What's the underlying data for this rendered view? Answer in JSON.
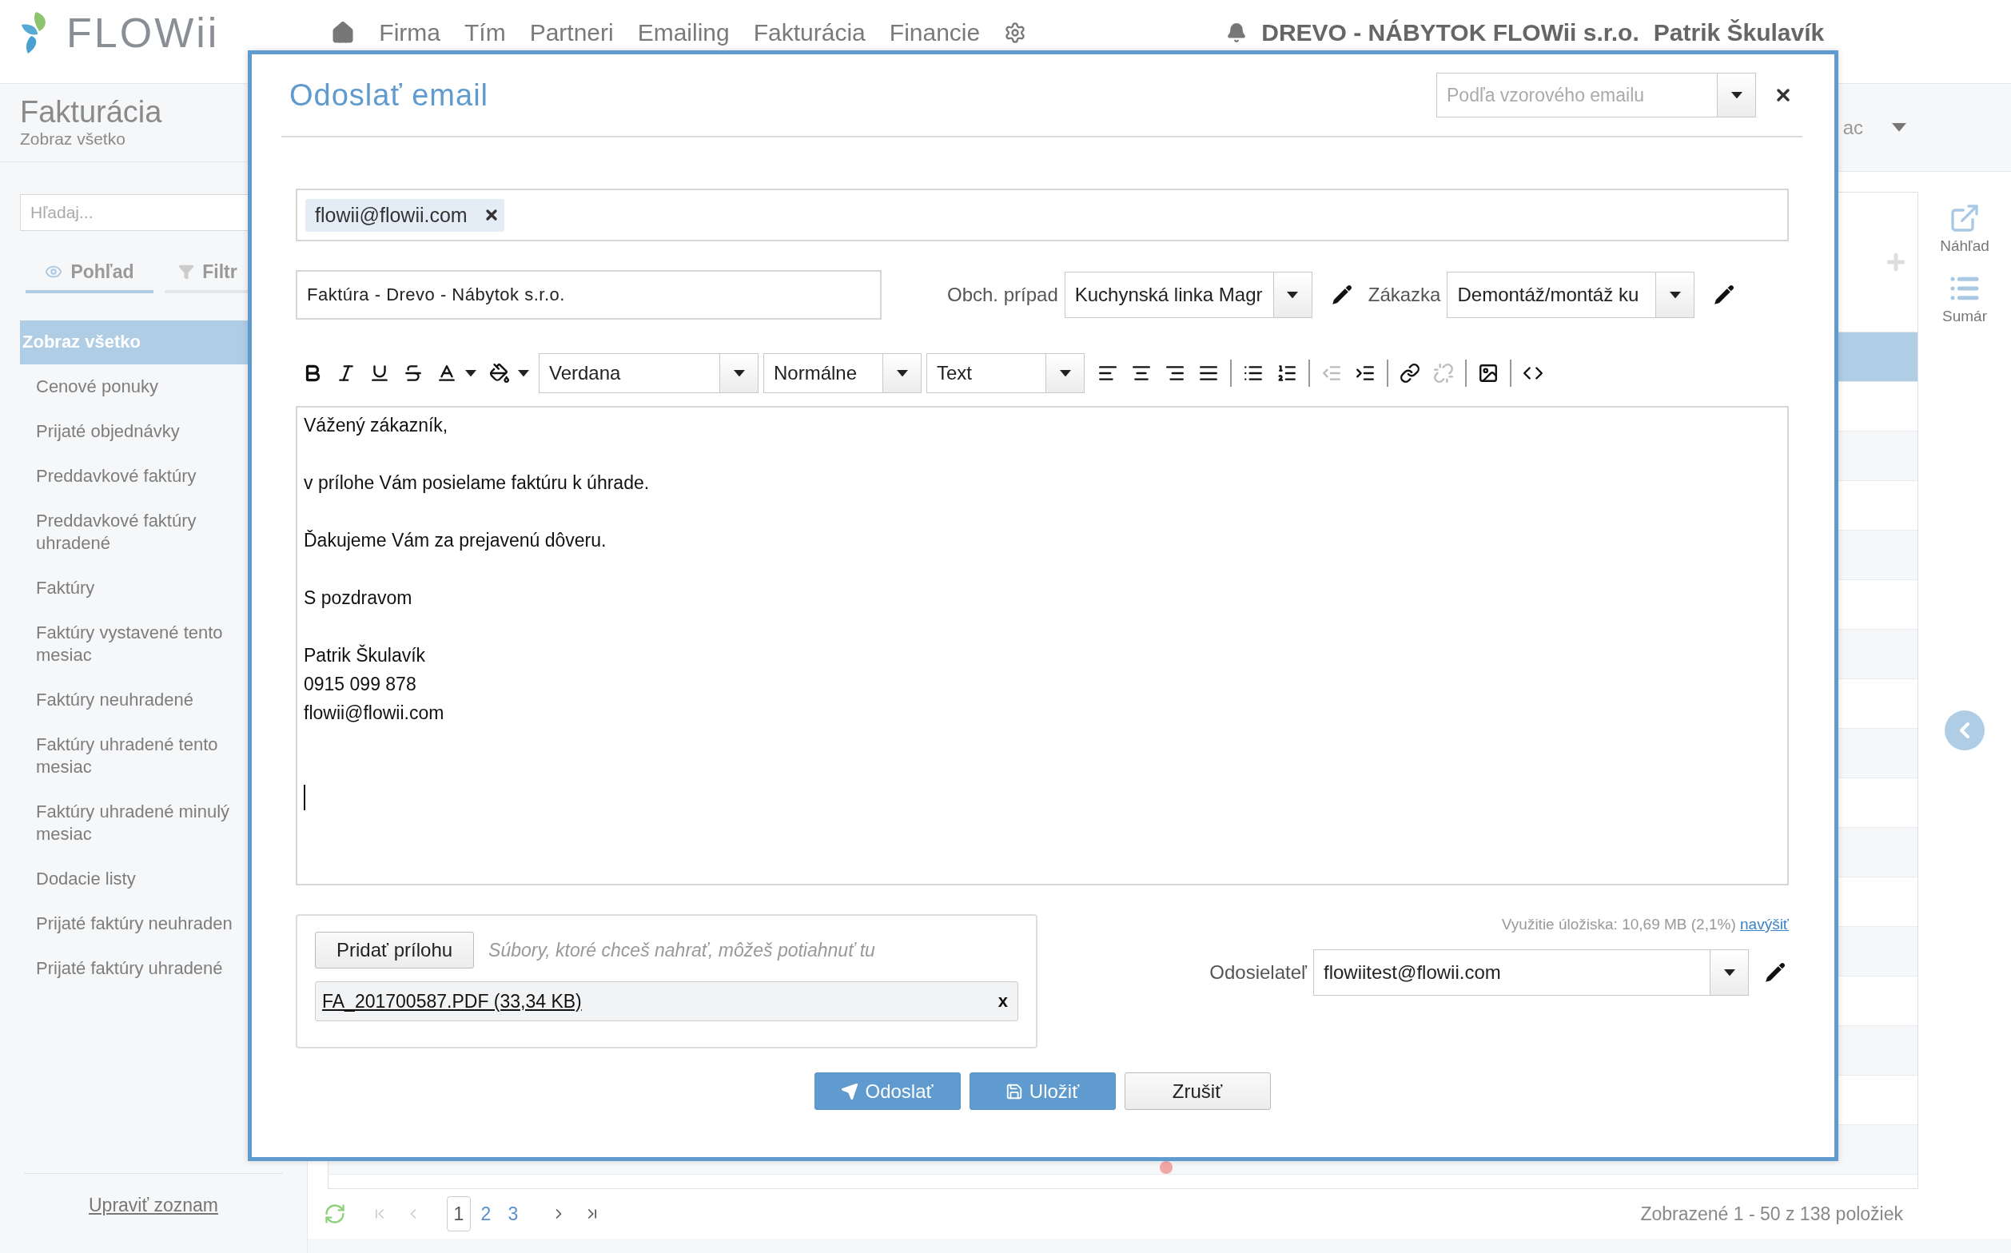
{
  "header": {
    "logo": "FLOWii",
    "nav": [
      {
        "label": "Firma"
      },
      {
        "label": "Tím"
      },
      {
        "label": "Partneri"
      },
      {
        "label": "Emailing"
      },
      {
        "label": "Fakturácia"
      },
      {
        "label": "Financie"
      }
    ],
    "company": "DREVO - NÁBYTOK FLOWii s.r.o.",
    "user": "Patrik Škulavík"
  },
  "sidebar": {
    "title": "Fakturácia",
    "subtitle": "Zobraz všetko",
    "search_placeholder": "Hľadaj...",
    "tabs": [
      {
        "label": "Pohľad",
        "kind": "view",
        "selected": true
      },
      {
        "label": "Filtr",
        "kind": "filter",
        "selected": false
      }
    ],
    "items": [
      {
        "label": "Zobraz všetko",
        "selected": true
      },
      {
        "label": "Cenové ponuky",
        "selected": false
      },
      {
        "label": "Prijaté objednávky",
        "selected": false
      },
      {
        "label": "Preddavkové faktúry",
        "selected": false
      },
      {
        "label": "Preddavkové faktúry uhradené",
        "selected": false
      },
      {
        "label": "Faktúry",
        "selected": false
      },
      {
        "label": "Faktúry vystavené tento mesiac",
        "selected": false
      },
      {
        "label": "Faktúry neuhradené",
        "selected": false
      },
      {
        "label": "Faktúry uhradené tento mesiac",
        "selected": false
      },
      {
        "label": "Faktúry uhradené minulý mesiac",
        "selected": false
      },
      {
        "label": "Dodacie listy",
        "selected": false
      },
      {
        "label": "Prijaté faktúry neuhraden",
        "selected": false
      },
      {
        "label": "Prijaté faktúry uhradené",
        "selected": false
      }
    ],
    "footer_link": "Upraviť zoznam"
  },
  "main": {
    "filter_fragment": "ac",
    "table": {
      "rows": [
        {
          "selected": true
        },
        {
          "selected": false
        },
        {
          "selected": false
        },
        {
          "selected": false
        },
        {
          "selected": false
        },
        {
          "selected": false
        },
        {
          "selected": false
        },
        {
          "selected": false
        },
        {
          "selected": false
        },
        {
          "selected": false
        },
        {
          "selected": false
        },
        {
          "selected": false
        },
        {
          "selected": false
        },
        {
          "selected": false
        },
        {
          "selected": false
        },
        {
          "selected": false
        },
        {
          "selected": false,
          "color": "#f2a7a7"
        }
      ]
    },
    "tools": [
      {
        "kind": "preview",
        "label": "Náhľad"
      },
      {
        "kind": "summary",
        "label": "Sumár"
      }
    ],
    "pagination": {
      "pages": [
        {
          "label": "1",
          "selected": true
        },
        {
          "label": "2",
          "selected": false
        },
        {
          "label": "3",
          "selected": false
        }
      ],
      "summary": "Zobrazené 1 - 50 z 138 položiek"
    }
  },
  "dialog": {
    "title": "Odoslať email",
    "template_placeholder": "Podľa vzorového emailu",
    "recipients": [
      {
        "email": "flowii@flowii.com"
      }
    ],
    "subject": "Faktúra - Drevo - Nábytok s.r.o.",
    "business_case": {
      "label": "Obch. prípad",
      "value": "Kuchynská linka Magr"
    },
    "order": {
      "label": "Zákazka",
      "value": "Demontáž/montáž ku"
    },
    "toolbar": {
      "groups": [
        [
          {
            "kind": "bold"
          },
          {
            "kind": "italic"
          },
          {
            "kind": "underline"
          },
          {
            "kind": "strike"
          },
          {
            "kind": "text-color"
          },
          {
            "kind": "fill-color"
          }
        ],
        [
          {
            "kind": "align-left"
          },
          {
            "kind": "align-center"
          },
          {
            "kind": "align-right"
          },
          {
            "kind": "align-justify"
          }
        ],
        [
          {
            "kind": "bullet-list"
          },
          {
            "kind": "numbered-list"
          }
        ],
        [
          {
            "kind": "outdent",
            "disabled": true
          },
          {
            "kind": "indent",
            "disabled": false
          }
        ],
        [
          {
            "kind": "link",
            "disabled": false
          },
          {
            "kind": "unlink",
            "disabled": true
          }
        ],
        [
          {
            "kind": "image"
          }
        ],
        [
          {
            "kind": "code"
          }
        ]
      ],
      "font": "Verdana",
      "size": "Normálne",
      "style": "Text"
    },
    "body": [
      [
        "Vážený zákazník,"
      ],
      [
        "v prílohe Vám posielame faktúru k úhrade."
      ],
      [
        "Ďakujeme Vám za prejavenú dôveru."
      ],
      [
        "S pozdravom"
      ],
      [
        "Patrik Škulavík",
        "0915 099 878",
        "flowii@flowii.com"
      ]
    ],
    "attach_button": "Pridať prílohu",
    "attach_hint": "Súbory, ktoré chceš nahrať, môžeš potiahnuť tu",
    "attachments": [
      {
        "name": "FA_201700587.PDF (33,34 KB)",
        "remove": "x"
      }
    ],
    "storage": {
      "text": "Využitie úložiska: 10,69 MB (2,1%)",
      "link": "navýšiť"
    },
    "sender": {
      "label": "Odosielateľ",
      "value": "flowiitest@flowii.com"
    },
    "buttons": [
      {
        "kind": "send",
        "label": "Odoslať"
      },
      {
        "kind": "save",
        "label": "Uložiť"
      },
      {
        "kind": "cancel",
        "label": "Zrušiť"
      }
    ]
  }
}
